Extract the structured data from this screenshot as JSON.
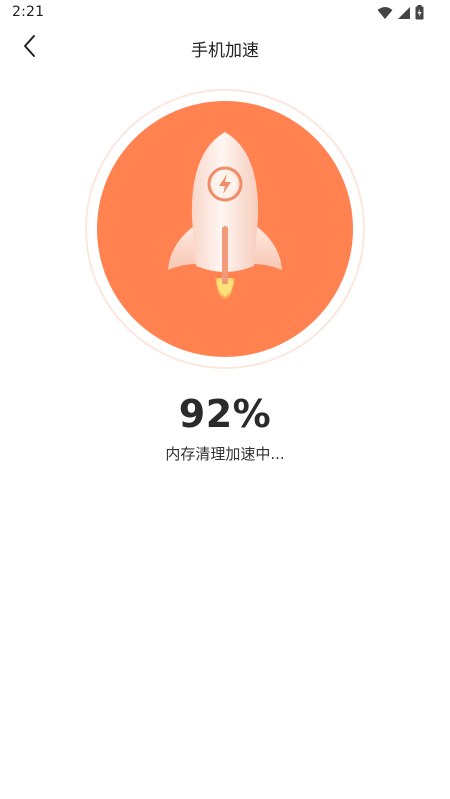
{
  "status_bar": {
    "time": "2:21"
  },
  "header": {
    "title": "手机加速",
    "back_icon": "chevron-left-icon"
  },
  "progress": {
    "percent_label": "92%",
    "value_fraction": 0.92,
    "status_text": "内存清理加速中..."
  },
  "colors": {
    "accent": "#FF8250",
    "ring": "#FCE7DE",
    "rocket_body": "#FDEEE8",
    "flame": "#FFE27A"
  },
  "icons": {
    "wifi": "wifi-icon",
    "signal": "cell-signal-icon",
    "battery": "battery-icon",
    "rocket": "rocket-icon",
    "bolt": "lightning-bolt-icon"
  }
}
